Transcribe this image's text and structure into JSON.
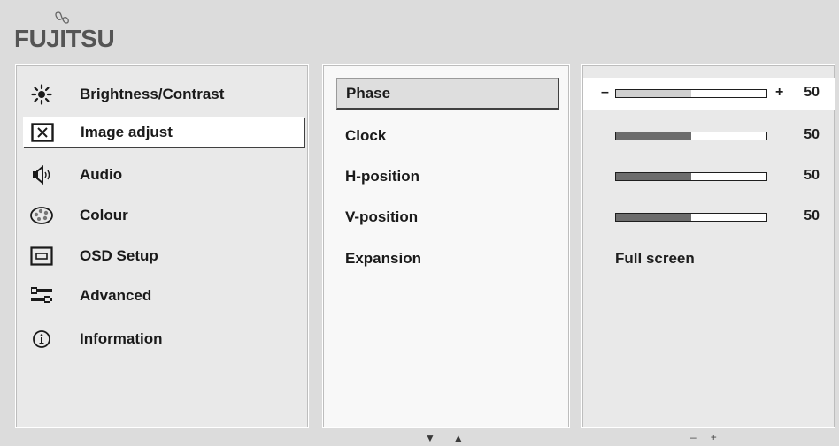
{
  "brand": {
    "logo_text": "FUJITSU"
  },
  "main_menu": [
    {
      "label": "Brightness/Contrast",
      "icon": "sun-icon",
      "selected": false
    },
    {
      "label": "Image adjust",
      "icon": "image-adjust-icon",
      "selected": true
    },
    {
      "label": "Audio",
      "icon": "speaker-icon",
      "selected": false
    },
    {
      "label": "Colour",
      "icon": "palette-icon",
      "selected": false
    },
    {
      "label": "OSD Setup",
      "icon": "osd-setup-icon",
      "selected": false
    },
    {
      "label": "Advanced",
      "icon": "sliders-icon",
      "selected": false
    },
    {
      "label": "Information",
      "icon": "info-icon",
      "selected": false
    }
  ],
  "sub_menu": [
    {
      "label": "Phase",
      "selected": true
    },
    {
      "label": "Clock",
      "selected": false
    },
    {
      "label": "H-position",
      "selected": false
    },
    {
      "label": "V-position",
      "selected": false
    },
    {
      "label": "Expansion",
      "selected": false
    }
  ],
  "values": [
    {
      "type": "slider",
      "value": "50",
      "level": 0.5,
      "minus": "–",
      "plus": "+"
    },
    {
      "type": "slider",
      "value": "50",
      "level": 0.5
    },
    {
      "type": "slider",
      "value": "50",
      "level": 0.5
    },
    {
      "type": "slider",
      "value": "50",
      "level": 0.5
    },
    {
      "type": "text",
      "value": "Full screen"
    }
  ],
  "footer": {
    "nav_down": "▼",
    "nav_up": "▲",
    "adj_minus": "–",
    "adj_plus": "+"
  },
  "colors": {
    "background": "#dcdcdc",
    "panel": "#e9e9e9",
    "panel_mid": "#f8f8f8",
    "selected": "#ffffff",
    "bar_fill": "#6c6c6c",
    "bar_fill_selected": "#cfcfcf"
  }
}
